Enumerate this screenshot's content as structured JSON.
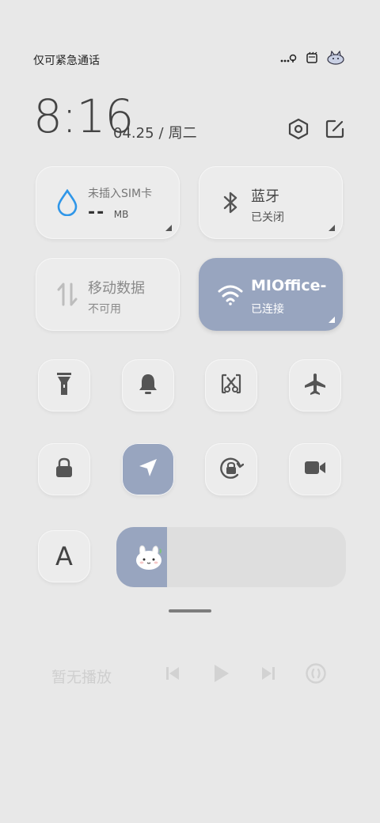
{
  "status": {
    "carrier": "仅可紧急通话",
    "icons": [
      "signal-dots-icon",
      "sim-icon",
      "pet-icon"
    ],
    "signal_text": "..."
  },
  "header": {
    "time": "8:16",
    "date": "04.25",
    "weekday": "周二",
    "icons": [
      "settings-icon",
      "edit-icon"
    ]
  },
  "tiles": [
    {
      "id": "sim-data",
      "title": "未插入SIM卡",
      "value": "--",
      "unit": "MB",
      "icon": "water-drop-icon",
      "accent": "#2f96e8"
    },
    {
      "id": "bluetooth",
      "title": "蓝牙",
      "sub": "已关闭",
      "icon": "bluetooth-icon"
    },
    {
      "id": "mobile-data",
      "title": "移动数据",
      "sub": "不可用",
      "icon": "data-arrows-icon"
    },
    {
      "id": "wifi",
      "title": "MIOffice-",
      "sub": "已连接",
      "icon": "wifi-icon",
      "state": "on"
    }
  ],
  "toggles": [
    {
      "id": "flashlight",
      "icon": "flashlight-icon",
      "state": "off"
    },
    {
      "id": "ring",
      "icon": "bell-icon",
      "state": "off"
    },
    {
      "id": "screenshot",
      "icon": "screenshot-scissors-icon",
      "state": "off"
    },
    {
      "id": "airplane",
      "icon": "airplane-icon",
      "state": "off"
    },
    {
      "id": "lock",
      "icon": "lock-icon",
      "state": "off"
    },
    {
      "id": "location",
      "icon": "location-arrow-icon",
      "state": "on"
    },
    {
      "id": "rotation",
      "icon": "rotation-lock-icon",
      "state": "off"
    },
    {
      "id": "video",
      "icon": "video-camera-icon",
      "state": "off"
    }
  ],
  "font_button": {
    "label": "A"
  },
  "brightness": {
    "level": 0.22,
    "icon": "bunny-icon"
  },
  "media": {
    "title": "暂无播放",
    "controls": [
      "previous-icon",
      "play-icon",
      "next-icon",
      "cast-icon"
    ]
  },
  "colors": {
    "accent": "#98a5bf",
    "background": "#e8e8e8",
    "tile": "#ececec"
  }
}
